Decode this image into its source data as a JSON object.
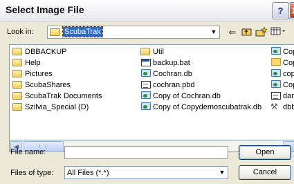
{
  "window": {
    "title": "Select Image File",
    "help_label": "?",
    "close_label": "X"
  },
  "lookin": {
    "label": "Look in:",
    "value": "ScubaTrak"
  },
  "files": {
    "column1": [
      {
        "name": "DBBACKUP",
        "icon": "folder-icon"
      },
      {
        "name": "Help",
        "icon": "folder-icon"
      },
      {
        "name": "Pictures",
        "icon": "folder-icon"
      },
      {
        "name": "ScubaShares",
        "icon": "folder-icon"
      },
      {
        "name": "ScubaTrak Documents",
        "icon": "folder-icon"
      },
      {
        "name": "Szilvia_Special (D)",
        "icon": "folder-icon"
      }
    ],
    "column2": [
      {
        "name": "Util",
        "icon": "folder-icon"
      },
      {
        "name": "backup.bat",
        "icon": "batch-file-icon"
      },
      {
        "name": "Cochran.db",
        "icon": "database-file-icon"
      },
      {
        "name": "cochran.pbd",
        "icon": "pbd-file-icon"
      },
      {
        "name": "Copy of Cochran.db",
        "icon": "database-file-icon"
      },
      {
        "name": "Copy of Copydemoscubatrak.db",
        "icon": "database-file-icon"
      }
    ],
    "column3": [
      {
        "name": "Cop",
        "icon": "database-file-icon"
      },
      {
        "name": "Cop",
        "icon": "shortcut-icon"
      },
      {
        "name": "cop",
        "icon": "database-file-icon"
      },
      {
        "name": "Cop",
        "icon": "database-file-icon"
      },
      {
        "name": "dan",
        "icon": "pbd-file-icon"
      },
      {
        "name": "dbb",
        "icon": "tool-icon"
      }
    ]
  },
  "filename": {
    "label": "File name:",
    "value": ""
  },
  "filetype": {
    "label": "Files of type:",
    "value": "All Files (*.*)"
  },
  "buttons": {
    "open": "Open",
    "cancel": "Cancel"
  }
}
